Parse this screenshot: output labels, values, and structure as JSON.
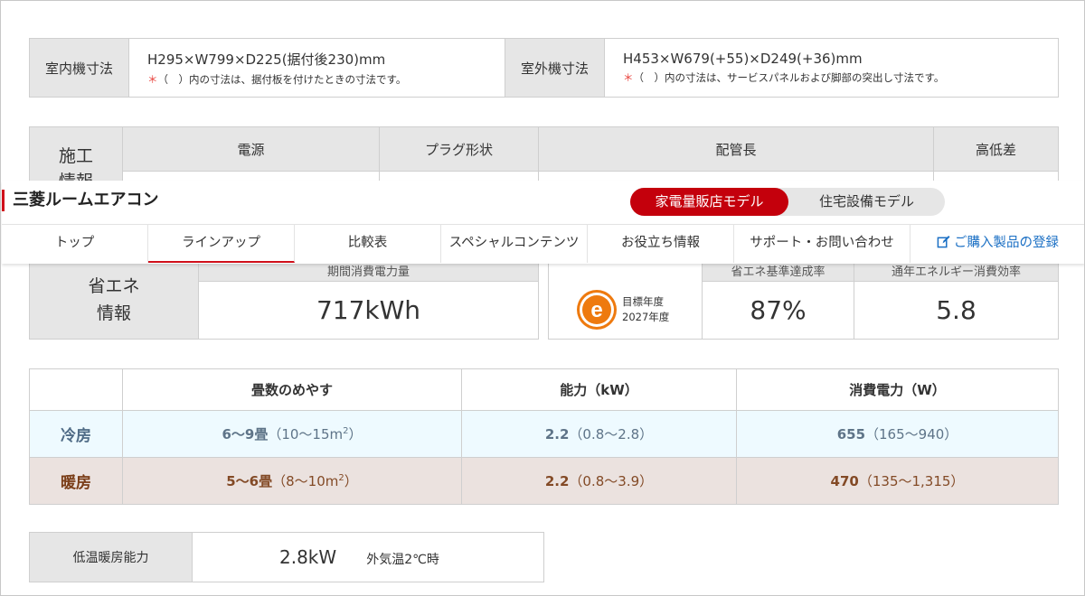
{
  "size": {
    "indoor_label": "室内機寸法",
    "indoor_value": "H295×W799×D225(据付後230)mm",
    "indoor_note_mark": "＊",
    "indoor_note": "（　）内の寸法は、据付板を付けたときの寸法です。",
    "outdoor_label": "室外機寸法",
    "outdoor_value": "H453×W679(+55)×D249(+36)mm",
    "outdoor_note_mark": "＊",
    "outdoor_note": "（　）内の寸法は、サービスパネルおよび脚部の突出し寸法です。"
  },
  "install": {
    "label_top": "施工",
    "label_bottom": "情報",
    "col_power": "電源",
    "col_plug": "プラグ形状",
    "col_pipe": "配管長",
    "col_height": "高低差"
  },
  "header": {
    "brand": "三菱ルームエアコン",
    "model_active": "家電量販店モデル",
    "model_inactive": "住宅設備モデル",
    "nav": [
      "トップ",
      "ラインアップ",
      "比較表",
      "スペシャルコンテンツ",
      "お役立ち情報",
      "サポート・お問い合わせ"
    ],
    "register": "ご購入製品の登録"
  },
  "energy": {
    "label_line1": "省エネ",
    "label_line2": "情報",
    "annual_header": "期間消費電力量",
    "annual_value": "717kWh",
    "target_line1": "目標年度",
    "target_line2": "2027年度",
    "achieve_header": "省エネ基準達成率",
    "achieve_value": "87%",
    "apf_header": "通年エネルギー消費効率",
    "apf_value": "5.8"
  },
  "performance": {
    "headers": [
      "畳数のめやす",
      "能力（kW）",
      "消費電力（W）"
    ],
    "cool": {
      "label": "冷房",
      "tatami_main": "6〜9畳",
      "tatami_sub": "（10〜15m",
      "tatami_sup": "2",
      "tatami_end": "）",
      "capacity_main": "2.2",
      "capacity_sub": "（0.8〜2.8）",
      "power_main": "655",
      "power_sub": "（165〜940）"
    },
    "heat": {
      "label": "暖房",
      "tatami_main": "5〜6畳",
      "tatami_sub": "（8〜10m",
      "tatami_sup": "2",
      "tatami_end": "）",
      "capacity_main": "2.2",
      "capacity_sub": "（0.8〜3.9）",
      "power_main": "470",
      "power_sub": "（135〜1,315）"
    }
  },
  "lowtemp": {
    "label": "低温暖房能力",
    "value": "2.8kW",
    "condition": "外気温2℃時"
  },
  "colors": {
    "brand_red": "#c4000c",
    "link_blue": "#1a6fc4",
    "note_red": "#e8413b",
    "cool_bg": "#eefaff",
    "heat_bg": "#ebe2df"
  }
}
